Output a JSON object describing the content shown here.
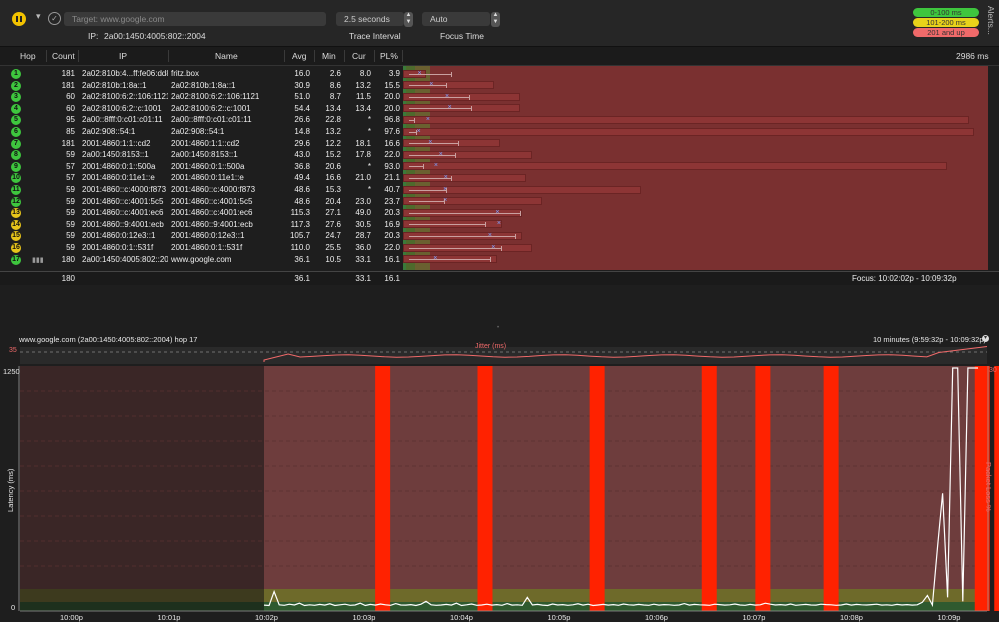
{
  "toolbar": {
    "target_placeholder": "Target:   www.google.com",
    "ip_label": "IP:",
    "ip_value": "2a00:1450:4005:802::2004",
    "interval_value": "2.5 seconds",
    "interval_label": "Trace Interval",
    "focus_value": "Auto",
    "focus_label": "Focus Time",
    "legend": [
      {
        "label": "0-100 ms",
        "color": "#3ec63e"
      },
      {
        "label": "101-200 ms",
        "color": "#e8d21a"
      },
      {
        "label": "201 and up",
        "color": "#f06a6a"
      }
    ],
    "alerts_label": "Alerts..."
  },
  "table": {
    "headers": {
      "hop": "Hop",
      "count": "Count",
      "ip": "IP",
      "name": "Name",
      "avg": "Avg",
      "min": "Min",
      "cur": "Cur",
      "pl": "PL%",
      "scale": "2986 ms"
    },
    "rows": [
      {
        "hop": "1",
        "color": "#3ec63e",
        "count": "181",
        "ip": "2a02:810b:4...ff:fe06:dd8d",
        "name": "fritz.box",
        "avg": "16.0",
        "min": "2.6",
        "cur": "8.0",
        "pl": "3.9"
      },
      {
        "hop": "2",
        "color": "#3ec63e",
        "count": "181",
        "ip": "2a02:810b:1:8a::1",
        "name": "2a02:810b:1:8a::1",
        "avg": "30.9",
        "min": "8.6",
        "cur": "13.2",
        "pl": "15.5"
      },
      {
        "hop": "3",
        "color": "#3ec63e",
        "count": "60",
        "ip": "2a02:8100:6:2::106:1121",
        "name": "2a02:8100:6:2::106:1121",
        "avg": "51.0",
        "min": "8.7",
        "cur": "11.5",
        "pl": "20.0"
      },
      {
        "hop": "4",
        "color": "#3ec63e",
        "count": "60",
        "ip": "2a02:8100:6:2::c:1001",
        "name": "2a02:8100:6:2::c:1001",
        "avg": "54.4",
        "min": "13.4",
        "cur": "13.4",
        "pl": "20.0"
      },
      {
        "hop": "5",
        "color": "#3ec63e",
        "count": "95",
        "ip": "2a00::8fff:0:c01:c01:11",
        "name": "2a00::8fff:0:c01:c01:11",
        "avg": "26.6",
        "min": "22.8",
        "cur": "*",
        "pl": "96.8"
      },
      {
        "hop": "6",
        "color": "#3ec63e",
        "count": "85",
        "ip": "2a02:908::54:1",
        "name": "2a02:908::54:1",
        "avg": "14.8",
        "min": "13.2",
        "cur": "*",
        "pl": "97.6"
      },
      {
        "hop": "7",
        "color": "#3ec63e",
        "count": "181",
        "ip": "2001:4860:1:1::cd2",
        "name": "2001:4860:1:1::cd2",
        "avg": "29.6",
        "min": "12.2",
        "cur": "18.1",
        "pl": "16.6"
      },
      {
        "hop": "8",
        "color": "#3ec63e",
        "count": "59",
        "ip": "2a00:1450:8153::1",
        "name": "2a00:1450:8153::1",
        "avg": "43.0",
        "min": "15.2",
        "cur": "17.8",
        "pl": "22.0"
      },
      {
        "hop": "9",
        "color": "#3ec63e",
        "count": "57",
        "ip": "2001:4860:0:1::500a",
        "name": "2001:4860:0:1::500a",
        "avg": "36.8",
        "min": "20.6",
        "cur": "*",
        "pl": "93.0"
      },
      {
        "hop": "10",
        "color": "#3ec63e",
        "count": "57",
        "ip": "2001:4860:0:11e1::e",
        "name": "2001:4860:0:11e1::e",
        "avg": "49.4",
        "min": "16.6",
        "cur": "21.0",
        "pl": "21.1"
      },
      {
        "hop": "11",
        "color": "#3ec63e",
        "count": "59",
        "ip": "2001:4860::c:4000:f873",
        "name": "2001:4860::c:4000:f873",
        "avg": "48.6",
        "min": "15.3",
        "cur": "*",
        "pl": "40.7"
      },
      {
        "hop": "12",
        "color": "#3ec63e",
        "count": "59",
        "ip": "2001:4860::c:4001:5c5",
        "name": "2001:4860::c:4001:5c5",
        "avg": "48.6",
        "min": "20.4",
        "cur": "23.0",
        "pl": "23.7"
      },
      {
        "hop": "13",
        "color": "#e8c51a",
        "count": "59",
        "ip": "2001:4860::c:4001:ec6",
        "name": "2001:4860::c:4001:ec6",
        "avg": "115.3",
        "min": "27.1",
        "cur": "49.0",
        "pl": "20.3"
      },
      {
        "hop": "14",
        "color": "#e8c51a",
        "count": "59",
        "ip": "2001:4860::9:4001:ecb",
        "name": "2001:4860::9:4001:ecb",
        "avg": "117.3",
        "min": "27.6",
        "cur": "30.5",
        "pl": "16.9"
      },
      {
        "hop": "15",
        "color": "#e8c51a",
        "count": "59",
        "ip": "2001:4860:0:12e3::1",
        "name": "2001:4860:0:12e3::1",
        "avg": "105.7",
        "min": "24.7",
        "cur": "28.7",
        "pl": "20.3"
      },
      {
        "hop": "16",
        "color": "#e8c51a",
        "count": "59",
        "ip": "2001:4860:0:1::531f",
        "name": "2001:4860:0:1::531f",
        "avg": "110.0",
        "min": "25.5",
        "cur": "36.0",
        "pl": "22.0"
      },
      {
        "hop": "17",
        "color": "#3ec63e",
        "count": "180",
        "ip": "2a00:1450:4005:802::2004",
        "name": "www.google.com",
        "avg": "36.1",
        "min": "10.5",
        "cur": "33.1",
        "pl": "16.1"
      }
    ],
    "summary": {
      "count": "180",
      "avg": "36.1",
      "cur": "33.1",
      "pl": "16.1",
      "focus": "Focus: 10:02:02p - 10:09:32p"
    }
  },
  "lower_graph": {
    "title": "www.google.com (2a00:1450:4005:802::2004) hop 17",
    "range": "10 minutes (9:59:32p - 10:09:32p)",
    "jitter_label": "Jitter (ms)",
    "jitter_max": "35",
    "y_left_label": "Latency (ms)",
    "y_right_label": "Packet Loss %",
    "y_left_max": "1250",
    "y_left_min": "0",
    "y_right_max": "30",
    "x_ticks": [
      "10:00p",
      "10:01p",
      "10:02p",
      "10:03p",
      "10:04p",
      "10:05p",
      "10:06p",
      "10:07p",
      "10:08p",
      "10:09p"
    ],
    "loss_bar_minutes": [
      3.15,
      4.2,
      5.35,
      6.5,
      7.05,
      7.75,
      9.3,
      9.5,
      9.65
    ],
    "latency_samples_ms": [
      20,
      18,
      90,
      22,
      19,
      25,
      21,
      30,
      18,
      22,
      19,
      24,
      20,
      27,
      18,
      22,
      25,
      19,
      21,
      30,
      18,
      24,
      20,
      26,
      22,
      19,
      28,
      21,
      20,
      23,
      18,
      25,
      40,
      22,
      19,
      21,
      24,
      20,
      30,
      18,
      22,
      26,
      19,
      21,
      25,
      20,
      23,
      19,
      28,
      20,
      22,
      19,
      60,
      21,
      24,
      20,
      18,
      26,
      21,
      23,
      19,
      22,
      27,
      20,
      25,
      18,
      21,
      24,
      20,
      23,
      19,
      26,
      22,
      20,
      24,
      21,
      19,
      25,
      20,
      23,
      22,
      19,
      21,
      28,
      20,
      24,
      22,
      21,
      19,
      25,
      23,
      20,
      22,
      26,
      21,
      19,
      24,
      20,
      22,
      30,
      25,
      21,
      23,
      20,
      26,
      19,
      22,
      24,
      21,
      20,
      25,
      23,
      22,
      19,
      21,
      26,
      20,
      24,
      22,
      21,
      23,
      25,
      20,
      22,
      19,
      24,
      21,
      23,
      20,
      22,
      35,
      70,
      21,
      320,
      600,
      60,
      1250,
      1250,
      40,
      1250,
      1250,
      1250
    ]
  }
}
